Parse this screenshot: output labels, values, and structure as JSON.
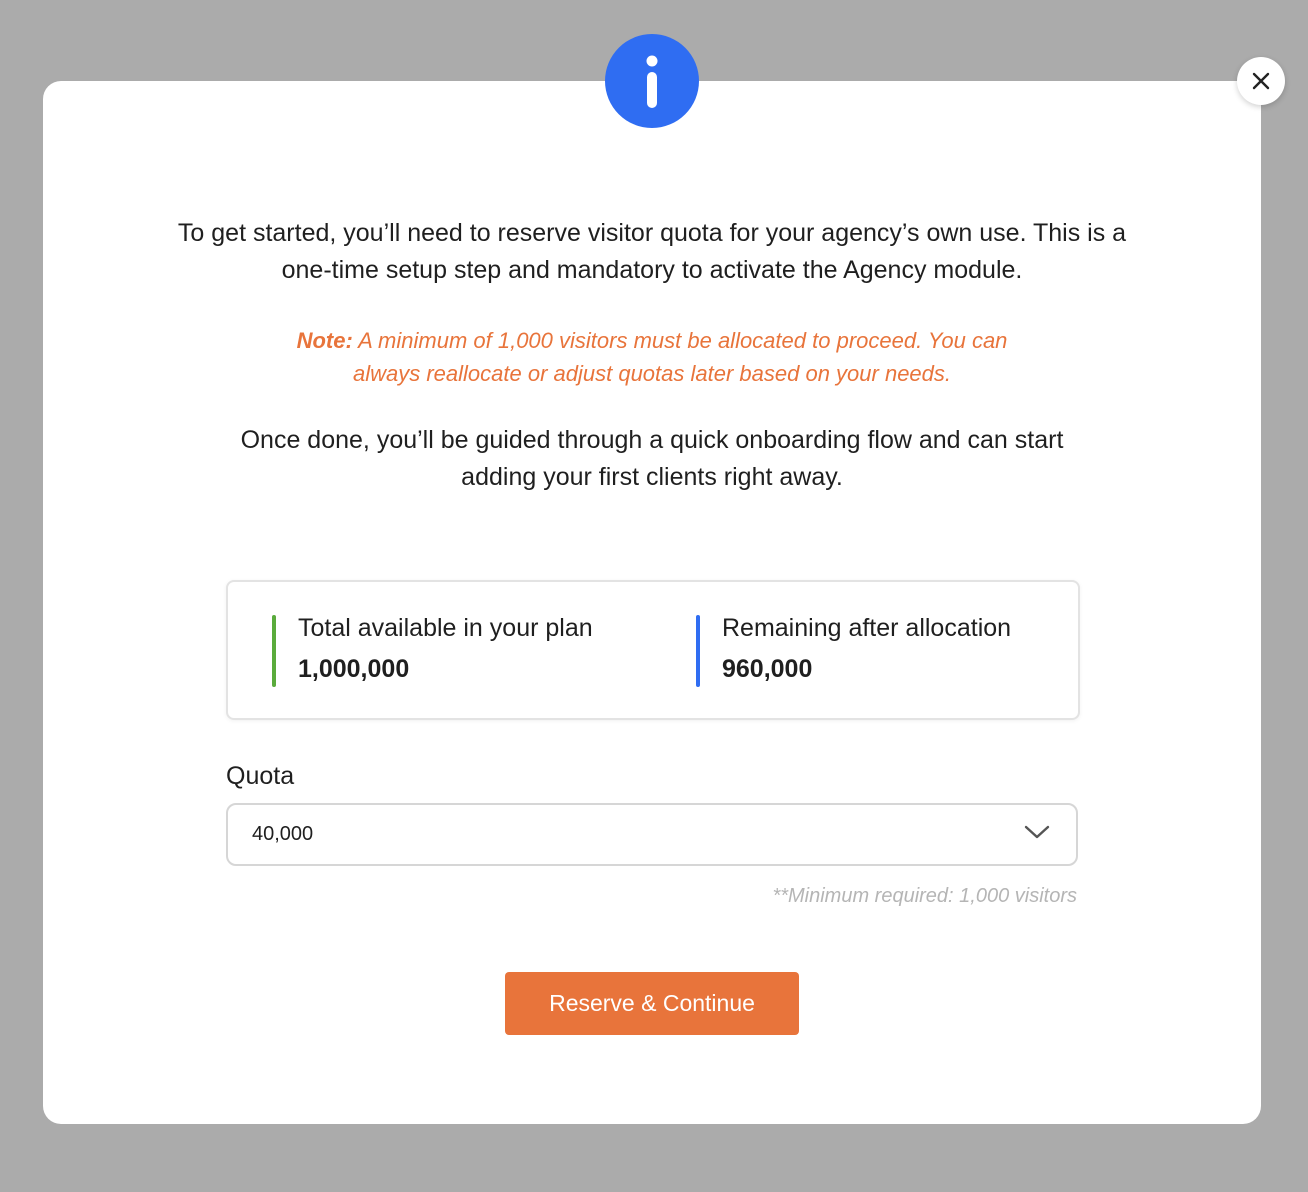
{
  "modal": {
    "close_icon": "close-icon",
    "info_icon": "info-icon",
    "intro_lines": [
      "To get started, you’ll need to reserve visitor quota for your agency’s own use. This is a",
      "one-time setup step and mandatory to activate the Agency module."
    ],
    "note": {
      "prefix": "Note:",
      "line1": " A minimum of 1,000 visitors must be allocated to proceed. You can",
      "line2": "always reallocate or adjust quotas later based on your needs."
    },
    "outro_lines": [
      "Once done, you’ll be guided through a quick onboarding flow and can start",
      "adding your first clients right away."
    ],
    "stats": {
      "total": {
        "label": "Total available in your plan",
        "value": "1,000,000",
        "color": "#5aab3c"
      },
      "remaining": {
        "label": "Remaining after allocation",
        "value": "960,000",
        "color": "#2f6df2"
      }
    },
    "quota": {
      "label": "Quota",
      "selected": "40,000",
      "chevron_icon": "chevron-down-icon",
      "hint": "**Minimum required: 1,000 visitors"
    },
    "cta_label": "Reserve & Continue"
  },
  "colors": {
    "backdrop": "#ababab",
    "accent_blue": "#2f6df2",
    "accent_orange": "#e8743b",
    "green": "#5aab3c"
  }
}
